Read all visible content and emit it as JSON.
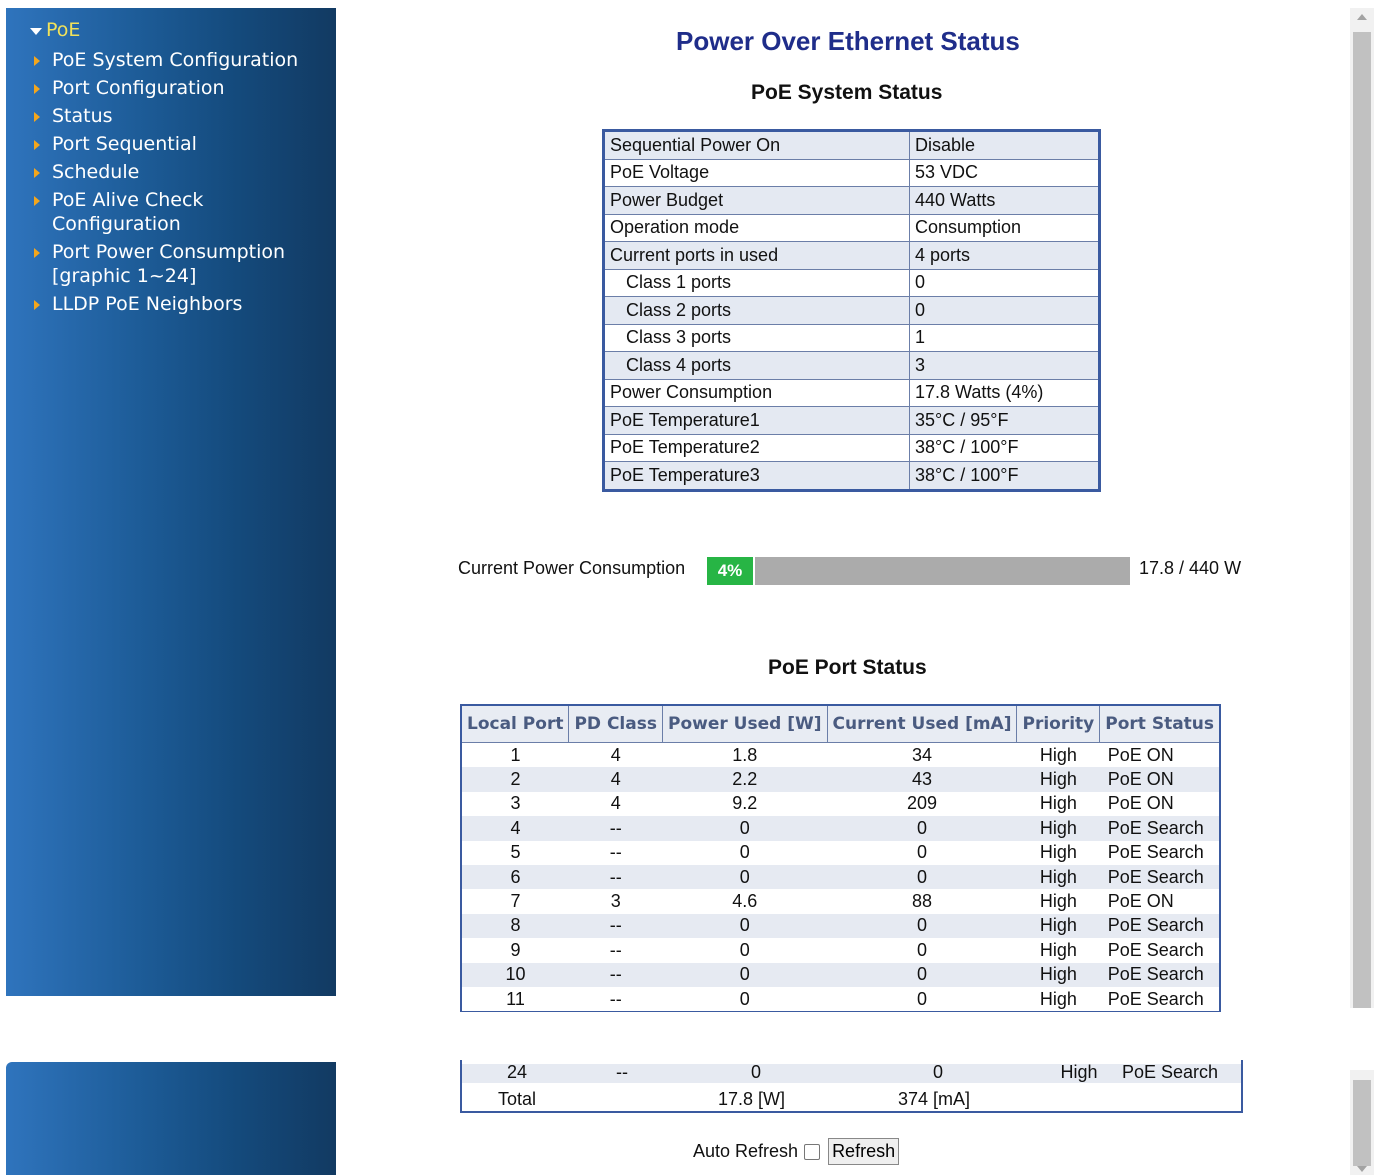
{
  "sidebar": {
    "header": "PoE",
    "items": [
      {
        "label": "PoE System Configuration"
      },
      {
        "label": "Port Configuration"
      },
      {
        "label": "Status"
      },
      {
        "label": "Port Sequential"
      },
      {
        "label": "Schedule"
      },
      {
        "label": "PoE Alive Check\nConfiguration"
      },
      {
        "label": "Port Power Consumption\n[graphic 1~24]"
      },
      {
        "label": "LLDP PoE Neighbors"
      }
    ]
  },
  "page": {
    "title": "Power Over Ethernet Status",
    "system_title": "PoE System Status",
    "port_title": "PoE Port Status"
  },
  "system_status": [
    {
      "key": "Sequential Power On",
      "value": "Disable"
    },
    {
      "key": "PoE Voltage",
      "value": "53 VDC"
    },
    {
      "key": "Power Budget",
      "value": "440 Watts"
    },
    {
      "key": "Operation mode",
      "value": "Consumption"
    },
    {
      "key": "Current ports in used",
      "value": "4 ports"
    },
    {
      "key": "Class 1 ports",
      "value": "0",
      "indent": true
    },
    {
      "key": "Class 2 ports",
      "value": "0",
      "indent": true
    },
    {
      "key": "Class 3 ports",
      "value": "1",
      "indent": true
    },
    {
      "key": "Class 4 ports",
      "value": "3",
      "indent": true
    },
    {
      "key": "Power Consumption",
      "value": "17.8 Watts (4%)"
    },
    {
      "key": "PoE Temperature1",
      "value": "35°C / 95°F"
    },
    {
      "key": "PoE Temperature2",
      "value": "38°C / 100°F"
    },
    {
      "key": "PoE Temperature3",
      "value": "38°C / 100°F"
    }
  ],
  "consumption": {
    "label": "Current Power Consumption",
    "percent_text": "4%",
    "percent": 4,
    "value_text": "17.8 / 440 W",
    "bar_color": "#27b545"
  },
  "port_table": {
    "headers": [
      "Local Port",
      "PD Class",
      "Power Used [W]",
      "Current Used [mA]",
      "Priority",
      "Port Status"
    ],
    "rows": [
      [
        "1",
        "4",
        "1.8",
        "34",
        "High",
        "PoE ON"
      ],
      [
        "2",
        "4",
        "2.2",
        "43",
        "High",
        "PoE ON"
      ],
      [
        "3",
        "4",
        "9.2",
        "209",
        "High",
        "PoE ON"
      ],
      [
        "4",
        "--",
        "0",
        "0",
        "High",
        "PoE Search"
      ],
      [
        "5",
        "--",
        "0",
        "0",
        "High",
        "PoE Search"
      ],
      [
        "6",
        "--",
        "0",
        "0",
        "High",
        "PoE Search"
      ],
      [
        "7",
        "3",
        "4.6",
        "88",
        "High",
        "PoE ON"
      ],
      [
        "8",
        "--",
        "0",
        "0",
        "High",
        "PoE Search"
      ],
      [
        "9",
        "--",
        "0",
        "0",
        "High",
        "PoE Search"
      ],
      [
        "10",
        "--",
        "0",
        "0",
        "High",
        "PoE Search"
      ],
      [
        "11",
        "--",
        "0",
        "0",
        "High",
        "PoE Search"
      ]
    ],
    "last_row": [
      "24",
      "--",
      "0",
      "0",
      "High",
      "PoE Search"
    ],
    "total": {
      "label": "Total",
      "power": "17.8 [W]",
      "current": "374 [mA]"
    }
  },
  "footer": {
    "auto_refresh_label": "Auto Refresh",
    "auto_refresh_checked": false,
    "refresh_button": "Refresh"
  }
}
